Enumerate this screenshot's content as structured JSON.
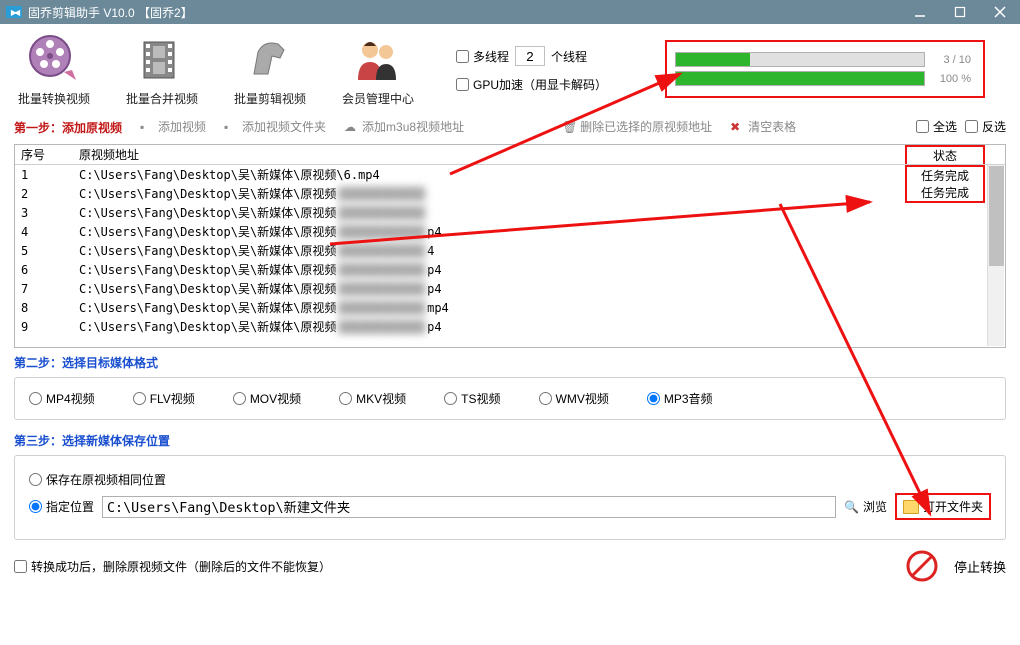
{
  "window": {
    "title": "固乔剪辑助手 V10.0   【固乔2】"
  },
  "toolbar": {
    "convert": "批量转换视频",
    "merge": "批量合并视频",
    "clip": "批量剪辑视频",
    "member": "会员管理中心"
  },
  "thread": {
    "multi_label": "多线程",
    "count": "2",
    "count_suffix": "个线程",
    "gpu_label": "GPU加速（用显卡解码）"
  },
  "progress": {
    "p1_fill": 30,
    "p1_text": "3 / 10",
    "p2_fill": 100,
    "p2_text": "100 %"
  },
  "step1": {
    "label": "第一步：添加原视频",
    "add_video": "添加视频",
    "add_folder": "添加视频文件夹",
    "add_m3u8": "添加m3u8视频地址",
    "delete_sel": "删除已选择的原视频地址",
    "clear": "清空表格",
    "select_all": "全选",
    "invert": "反选"
  },
  "table": {
    "col_num": "序号",
    "col_path": "原视频地址",
    "col_status": "状态",
    "rows": [
      {
        "n": "1",
        "path": "C:\\Users\\Fang\\Desktop\\吴\\新媒体\\原视频\\6.mp4",
        "status": "任务完成",
        "clear": true
      },
      {
        "n": "2",
        "path": "C:\\Users\\Fang\\Desktop\\吴\\新媒体\\原视频",
        "status": "任务完成"
      },
      {
        "n": "3",
        "path": "C:\\Users\\Fang\\Desktop\\吴\\新媒体\\原视频",
        "status": ""
      },
      {
        "n": "4",
        "path": "C:\\Users\\Fang\\Desktop\\吴\\新媒体\\原视频",
        "status": "",
        "tail": "p4"
      },
      {
        "n": "5",
        "path": "C:\\Users\\Fang\\Desktop\\吴\\新媒体\\原视频",
        "status": "",
        "tail": "4"
      },
      {
        "n": "6",
        "path": "C:\\Users\\Fang\\Desktop\\吴\\新媒体\\原视频",
        "status": "",
        "tail": "p4"
      },
      {
        "n": "7",
        "path": "C:\\Users\\Fang\\Desktop\\吴\\新媒体\\原视频",
        "status": "",
        "tail": "p4"
      },
      {
        "n": "8",
        "path": "C:\\Users\\Fang\\Desktop\\吴\\新媒体\\原视频",
        "status": "",
        "tail": "mp4"
      },
      {
        "n": "9",
        "path": "C:\\Users\\Fang\\Desktop\\吴\\新媒体\\原视频",
        "status": "",
        "tail": "p4"
      }
    ]
  },
  "step2": {
    "label": "第二步：选择目标媒体格式",
    "mp4": "MP4视频",
    "flv": "FLV视频",
    "mov": "MOV视频",
    "mkv": "MKV视频",
    "ts": "TS视频",
    "wmv": "WMV视频",
    "mp3": "MP3音频"
  },
  "step3": {
    "label": "第三步：选择新媒体保存位置",
    "same_loc": "保存在原视频相同位置",
    "spec_loc": "指定位置",
    "path": "C:\\Users\\Fang\\Desktop\\新建文件夹",
    "browse": "浏览",
    "open_folder": "打开文件夹"
  },
  "bottom": {
    "delete_after": "转换成功后，删除原视频文件（删除后的文件不能恢复）",
    "stop": "停止转换"
  }
}
